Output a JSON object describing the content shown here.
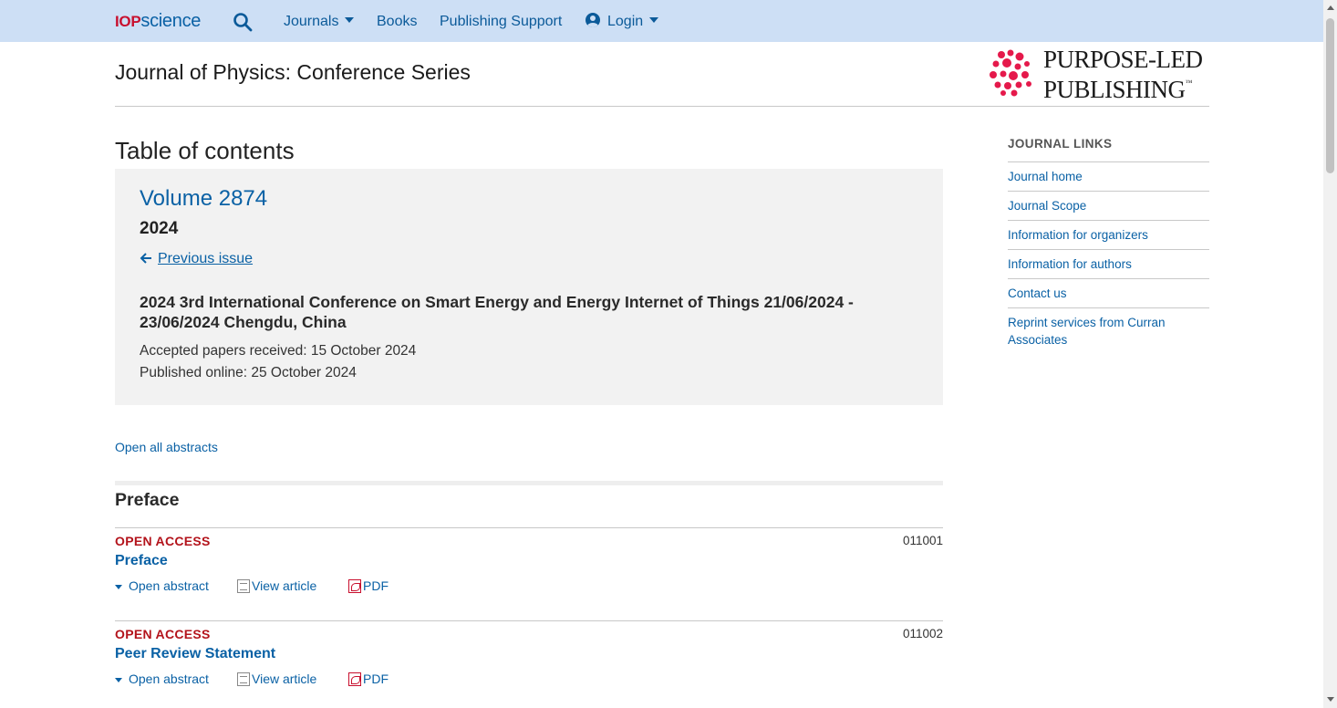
{
  "nav": {
    "logo_iop": "IOP",
    "logo_science": "science",
    "search_icon": "search-icon",
    "items": [
      "Journals",
      "Books",
      "Publishing Support",
      "Login"
    ]
  },
  "header": {
    "journal_title": "Journal of Physics: Conference Series",
    "publisher_logo_line1": "PURPOSE-LED",
    "publisher_logo_line2": "PUBLISHING",
    "trademark": "™"
  },
  "toc": {
    "heading": "Table of contents",
    "volume": "Volume 2874",
    "year": "2024",
    "previous_issue": "Previous issue",
    "conference_title": "2024 3rd International Conference on Smart Energy and Energy Internet of Things 21/06/2024 - 23/06/2024 Chengdu, China",
    "accepted": "Accepted papers received: 15 October 2024",
    "published": "Published online: 25 October 2024"
  },
  "open_all_abstracts": "Open all abstracts",
  "section": {
    "title": "Preface",
    "articles": [
      {
        "access": "OPEN ACCESS",
        "number": "011001",
        "title": "Preface",
        "open_abstract": "Open abstract",
        "view_article": "View article",
        "pdf": "PDF"
      },
      {
        "access": "OPEN ACCESS",
        "number": "011002",
        "title": "Peer Review Statement",
        "open_abstract": "Open abstract",
        "view_article": "View article",
        "pdf": "PDF"
      }
    ]
  },
  "sidebar": {
    "heading": "JOURNAL LINKS",
    "links": [
      "Journal home",
      "Journal Scope",
      "Information for organizers",
      "Information for authors",
      "Contact us",
      "Reprint services from Curran Associates"
    ]
  },
  "colors": {
    "nav_bg": "#cddff5",
    "link": "#0a61a5",
    "open_access": "#b3131b",
    "logo_red": "#c8102e",
    "volume_box_bg": "#f2f2f2"
  }
}
